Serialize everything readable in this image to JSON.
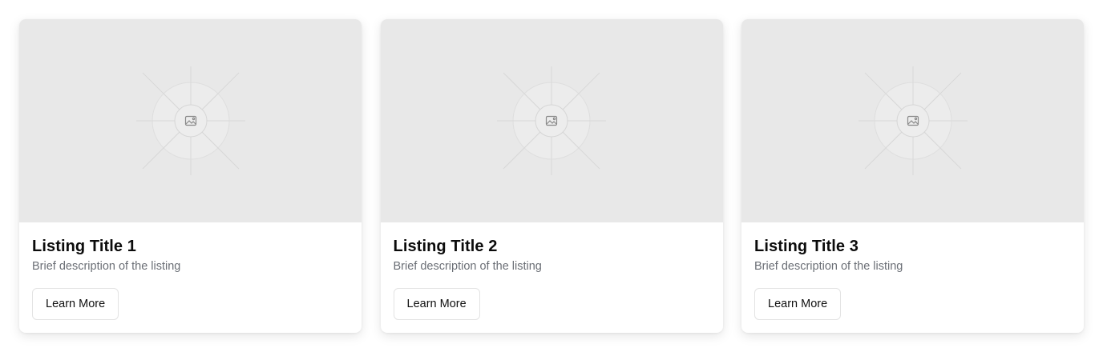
{
  "listings": [
    {
      "title": "Listing Title 1",
      "description": "Brief description of the listing",
      "button_label": "Learn More",
      "image_icon": "image-placeholder-icon"
    },
    {
      "title": "Listing Title 2",
      "description": "Brief description of the listing",
      "button_label": "Learn More",
      "image_icon": "image-placeholder-icon"
    },
    {
      "title": "Listing Title 3",
      "description": "Brief description of the listing",
      "button_label": "Learn More",
      "image_icon": "image-placeholder-icon"
    }
  ],
  "colors": {
    "card_background": "#ffffff",
    "media_background": "#e8e8e8",
    "title": "#0b0b0b",
    "description": "#6b6f76",
    "button_border": "#e3e3e3"
  }
}
